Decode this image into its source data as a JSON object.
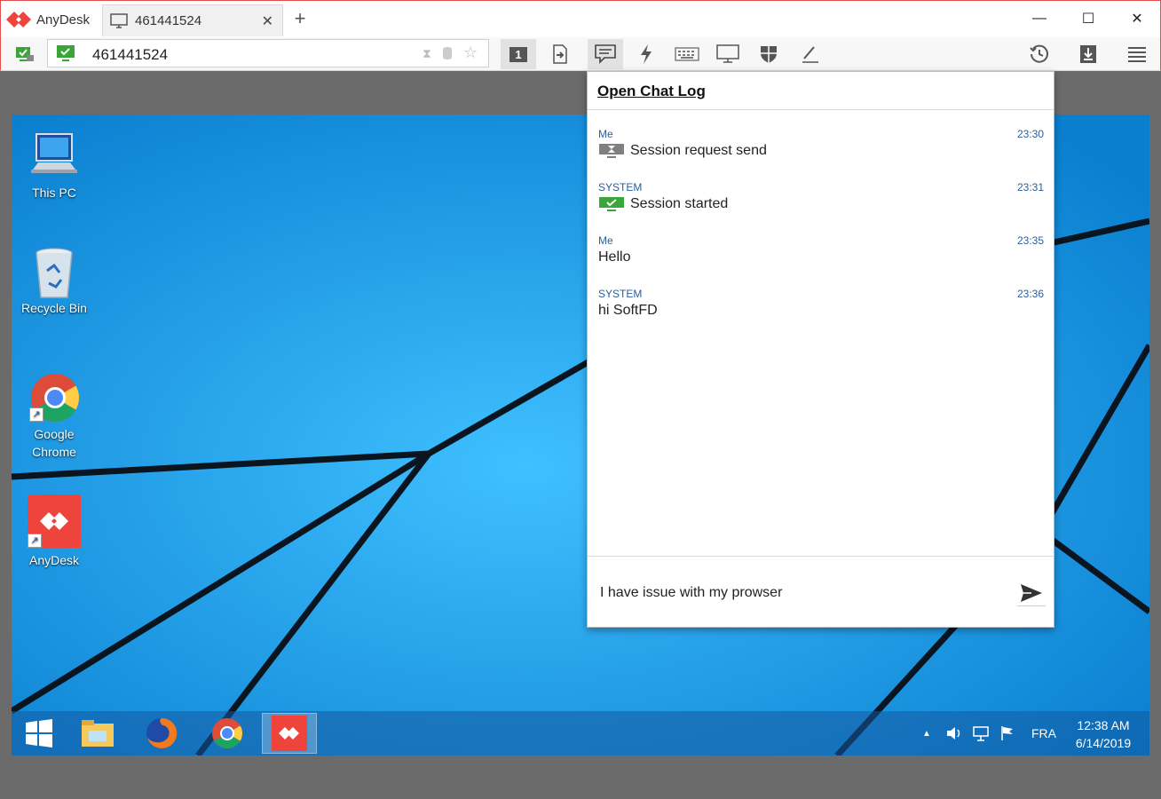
{
  "titlebar": {
    "app_name": "AnyDesk",
    "tab_label": "461441524",
    "new_tab_symbol": "+",
    "tab_close_symbol": "✕",
    "minimize_symbol": "—",
    "maximize_symbol": "☐",
    "close_symbol": "✕"
  },
  "toolbar": {
    "address_value": "461441524",
    "monitor_number": "1"
  },
  "chat": {
    "open_log_label": "Open Chat Log",
    "messages": [
      {
        "sender": "Me",
        "time": "23:30",
        "text": "Session request send",
        "icon": "hourglass-icon"
      },
      {
        "sender": "SYSTEM",
        "time": "23:31",
        "text": "Session started",
        "icon": "monitor-check-icon"
      },
      {
        "sender": "Me",
        "time": "23:35",
        "text": "Hello",
        "icon": ""
      },
      {
        "sender": "SYSTEM",
        "time": "23:36",
        "text": "hi SoftFD",
        "icon": ""
      }
    ],
    "input_value": "I have issue with my prowser"
  },
  "desktop": {
    "icons": [
      {
        "label": "This PC",
        "icon": "computer-icon"
      },
      {
        "label": "Recycle Bin",
        "icon": "recycle-bin-icon"
      },
      {
        "label": "Google Chrome",
        "icon": "chrome-icon"
      },
      {
        "label": "AnyDesk",
        "icon": "anydesk-icon"
      }
    ],
    "taskbar": {
      "language": "FRA",
      "time": "12:38 AM",
      "date": "6/14/2019",
      "tray_up_symbol": "▲"
    }
  },
  "colors": {
    "brand_red": "#ef443b",
    "desktop_blue": "#1aa3ee",
    "chat_meta": "#2a5d9a",
    "check_green": "#3aa63a"
  }
}
